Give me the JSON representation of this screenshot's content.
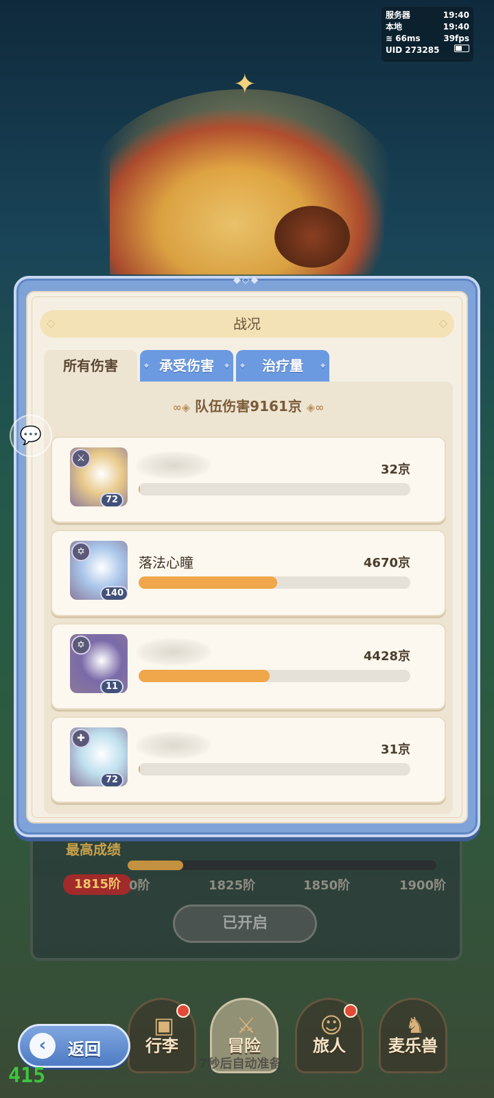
{
  "status_overlay": {
    "server_label": "服务器",
    "server_time": "19:40",
    "local_label": "本地",
    "local_time": "19:40",
    "ping": "66ms",
    "fps": "39fps",
    "uid": "UID 273285"
  },
  "background": {
    "best_record_label": "最高成绩",
    "best_rank": "1815阶",
    "progress_ticks": [
      "0阶",
      "1825阶",
      "1850阶",
      "1900阶"
    ],
    "opened_button": "已开启"
  },
  "modal": {
    "title": "战况",
    "tabs": [
      {
        "label": "所有伤害",
        "active": true
      },
      {
        "label": "承受伤害",
        "active": false
      },
      {
        "label": "治疗量",
        "active": false
      }
    ],
    "team_damage": "队伍伤害9161京",
    "entries": [
      {
        "name": "",
        "level": "72",
        "damage": "32京",
        "fraction": 0.003,
        "class_icon": "sword-icon",
        "portrait_color": "#e8c98a"
      },
      {
        "name": "落法心瞳",
        "level": "140",
        "damage": "4670京",
        "fraction": 0.51,
        "class_icon": "hexagram-icon",
        "portrait_color": "#a9c6ea"
      },
      {
        "name": "",
        "level": "11",
        "damage": "4428京",
        "fraction": 0.483,
        "class_icon": "hexagram-icon",
        "portrait_color": "#7a6aa8"
      },
      {
        "name": "",
        "level": "72",
        "damage": "31京",
        "fraction": 0.003,
        "class_icon": "cross-icon",
        "portrait_color": "#bfe0ef"
      }
    ]
  },
  "bottom_nav": {
    "items": [
      {
        "label": "行李",
        "has_dot": true
      },
      {
        "label": "冒险",
        "has_dot": false
      },
      {
        "label": "旅人",
        "has_dot": true
      },
      {
        "label": "麦乐兽",
        "has_dot": false
      }
    ],
    "prep_text": "7秒后自动准备"
  },
  "back_button": {
    "label": "返回"
  },
  "fps_counter": "415"
}
